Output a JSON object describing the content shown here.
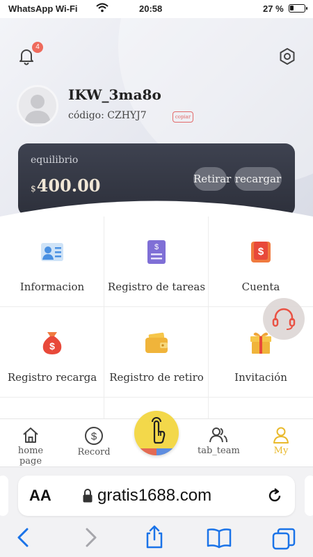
{
  "status_bar": {
    "carrier": "WhatsApp Wi-Fi",
    "time": "20:58",
    "battery": "27 %",
    "battery_level": 0.27
  },
  "header": {
    "notification_count": "4",
    "username": "IKW_3ma8o",
    "code_label": "código: CZHYJ7",
    "copy_label": "copiar"
  },
  "balance": {
    "label": "equilibrio",
    "currency": "$",
    "amount": "400.00",
    "withdraw_label": "Retirar",
    "recharge_label": "recargar"
  },
  "menu": {
    "items": [
      {
        "label": "Informacion",
        "icon": "id-card-icon"
      },
      {
        "label": "Registro de tareas",
        "icon": "receipt-icon"
      },
      {
        "label": "Cuenta",
        "icon": "dollar-tag-icon"
      },
      {
        "label": "Registro recarga",
        "icon": "money-bag-icon"
      },
      {
        "label": "Registro de retiro",
        "icon": "wallet-icon"
      },
      {
        "label": "Invitación",
        "icon": "gift-icon"
      }
    ]
  },
  "tabbar": {
    "items": [
      {
        "label": "home page",
        "icon": "home-icon"
      },
      {
        "label": "Record",
        "icon": "dollar-circle-icon"
      },
      {
        "label": "tab_team",
        "icon": "team-icon"
      },
      {
        "label": "My",
        "icon": "user-icon"
      }
    ],
    "active": "My"
  },
  "browser": {
    "aa_label": "AA",
    "url": "gratis1688.com"
  },
  "colors": {
    "accent_yellow": "#e9b92b",
    "badge_red": "#ee6a5c",
    "card_dark": "#2d303b",
    "ios_blue": "#1a73e8"
  }
}
